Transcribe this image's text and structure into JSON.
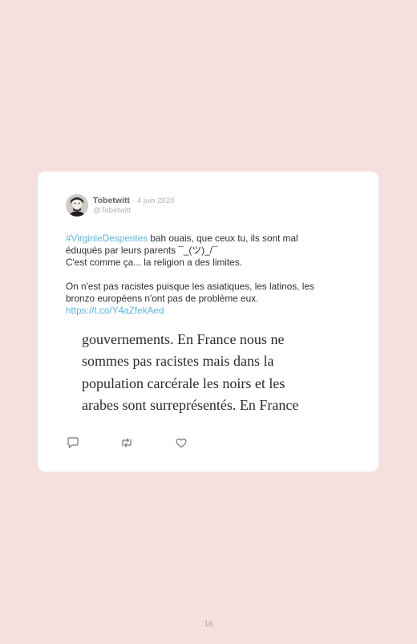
{
  "tweet": {
    "author_name": "Tobetwitt",
    "separator": "·",
    "date": "4 juin 2020",
    "handle": "@Tobetwitt",
    "lines": [
      {
        "hashtag": "#VirginieDespentes",
        "text": " bah ouais, que ceux tu, ils sont mal"
      },
      {
        "text": "éduqués par leurs parents ¯_(ツ)_/¯"
      },
      {
        "text": "C'est comme ça... la religion a des limites."
      },
      {
        "text": "On n'est pas racistes puisque les asiatiques, les latinos, les"
      },
      {
        "text": "bronzo européens n'ont pas de problème eux."
      }
    ],
    "link": "https://t.co/Y4aZfekAed"
  },
  "quote": {
    "lines": [
      "gouvernements. En France nous ne",
      "sommes pas racistes mais dans la",
      "population carcérale les noirs et les",
      "arabes sont surreprésentés. En France"
    ]
  },
  "actions": {
    "reply": "reply-icon",
    "retweet": "retweet-icon",
    "like": "heart-icon"
  },
  "page": {
    "number": "16"
  },
  "colors": {
    "background": "#f5e0e0",
    "card": "#ffffff",
    "link": "#5fb6e6"
  }
}
